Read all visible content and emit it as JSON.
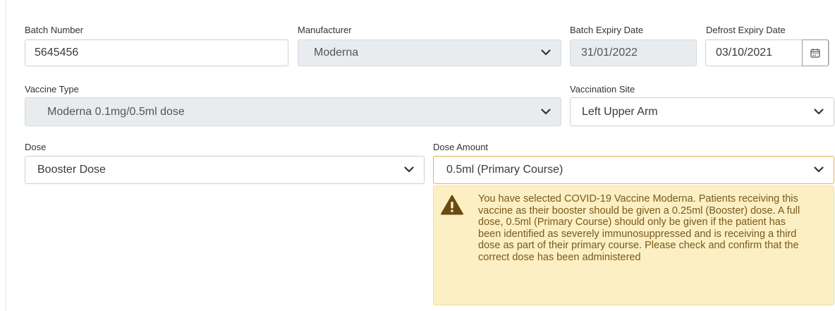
{
  "fields": {
    "batch_number": {
      "label": "Batch Number",
      "value": "5645456"
    },
    "manufacturer": {
      "label": "Manufacturer",
      "value": "Moderna"
    },
    "batch_expiry": {
      "label": "Batch Expiry Date",
      "value": "31/01/2022"
    },
    "defrost_expiry": {
      "label": "Defrost Expiry Date",
      "value": "03/10/2021"
    },
    "vaccine_type": {
      "label": "Vaccine Type",
      "value": "Moderna 0.1mg/0.5ml dose"
    },
    "vaccination_site": {
      "label": "Vaccination Site",
      "value": "Left Upper Arm"
    },
    "dose": {
      "label": "Dose",
      "value": "Booster Dose"
    },
    "dose_amount": {
      "label": "Dose Amount",
      "value": "0.5ml (Primary Course)"
    }
  },
  "warning": {
    "message": "You have selected COVID-19 Vaccine Moderna. Patients receiving this vaccine as their booster should be given a 0.25ml (Booster) dose. A full dose, 0.5ml (Primary Course) should only be given if the patient has been identified as severely immunosuppressed and is receiving a third dose as part of their primary course. Please check and confirm that the correct dose has been administered"
  },
  "icons": {
    "select_chevron": "chevron-down-icon",
    "calendar": "calendar-icon",
    "warning": "warning-triangle-icon"
  },
  "colors": {
    "warning_background": "#fcefc3",
    "warning_text": "#7a5a1c",
    "warning_icon": "#6b4a12",
    "disabled_field": "#e9ecef"
  }
}
